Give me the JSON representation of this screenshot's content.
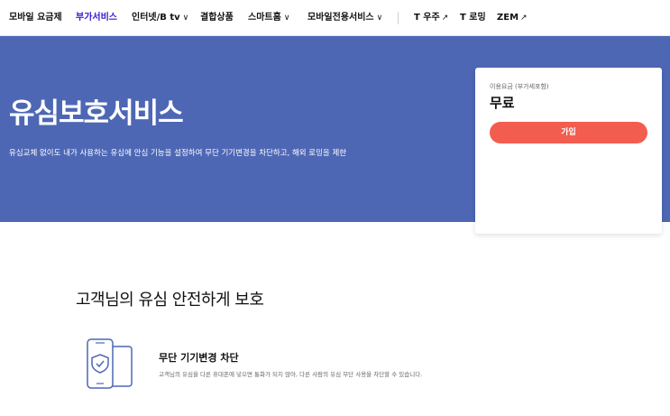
{
  "nav": {
    "items": [
      {
        "label": "모바일 요금제"
      },
      {
        "label": "부가서비스"
      },
      {
        "label": "인터넷/B tv"
      },
      {
        "label": "결합상품"
      },
      {
        "label": "스마트홈"
      },
      {
        "label": "모바일전용서비스"
      },
      {
        "label": "T 우주"
      },
      {
        "label": "T 로밍"
      },
      {
        "label": "ZEM"
      }
    ],
    "active_color": "#3617ce"
  },
  "hero": {
    "title": "유심보호서비스",
    "description": "유심교체 없이도 내가 사용하는 유심에 안심 기능을 설정하여 무단 기기변경을 차단하고, 해외 로밍을 제한",
    "background_color": "#4e67b5"
  },
  "fee_card": {
    "label": "이용요금 (부가세포함)",
    "price": "무료",
    "join_label": "가입",
    "button_color": "#f25d4f"
  },
  "content": {
    "section_title": "고객님의 유심 안전하게 보호",
    "features": [
      {
        "icon": "phone-shield-icon",
        "title": "무단 기기변경 차단",
        "description": "고객님의 유심을 다른 휴대폰에 넣으면 통화가 되지 않아, 다른 사람의 유심 무단 사용을 차단할 수 있습니다."
      }
    ]
  }
}
